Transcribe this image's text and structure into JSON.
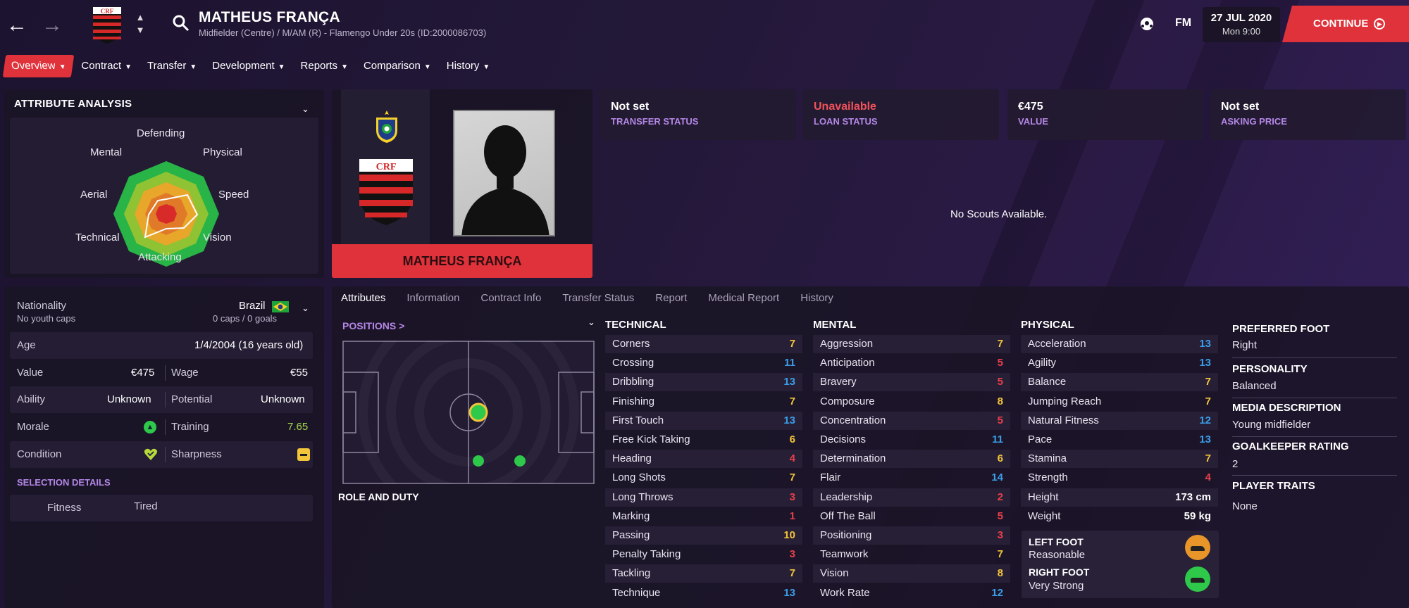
{
  "header": {
    "player_name": "MATHEUS FRANÇA",
    "player_subtitle": "Midfielder (Centre) / M/AM (R) - Flamengo Under 20s (ID:2000086703)",
    "fm_label": "FM",
    "date": "27 JUL 2020",
    "time": "Mon 9:00",
    "continue_label": "CONTINUE"
  },
  "menu": [
    {
      "label": "Overview"
    },
    {
      "label": "Contract"
    },
    {
      "label": "Transfer"
    },
    {
      "label": "Development"
    },
    {
      "label": "Reports"
    },
    {
      "label": "Comparison"
    },
    {
      "label": "History"
    }
  ],
  "attribute_analysis": {
    "title": "ATTRIBUTE ANALYSIS",
    "labels": {
      "defending": "Defending",
      "physical": "Physical",
      "speed": "Speed",
      "vision": "Vision",
      "attacking": "Attacking",
      "technical": "Technical",
      "aerial": "Aerial",
      "mental": "Mental"
    }
  },
  "info": {
    "nationality_label": "Nationality",
    "nationality_value": "Brazil",
    "youth_caps": "No youth caps",
    "caps": "0 caps / 0 goals",
    "age_label": "Age",
    "age_value": "1/4/2004 (16 years old)",
    "value_label": "Value",
    "value_value": "€475",
    "wage_label": "Wage",
    "wage_value": "€55",
    "ability_label": "Ability",
    "ability_value": "Unknown",
    "potential_label": "Potential",
    "potential_value": "Unknown",
    "morale_label": "Morale",
    "training_label": "Training",
    "training_value": "7.65",
    "condition_label": "Condition",
    "sharpness_label": "Sharpness",
    "selection_title": "SELECTION DETAILS",
    "fitness_label": "Fitness",
    "fitness_value": "Tired"
  },
  "card": {
    "name": "MATHEUS FRANÇA"
  },
  "status_tiles": [
    {
      "value": "Not set",
      "label": "TRANSFER STATUS",
      "color": "#ffffff"
    },
    {
      "value": "Unavailable",
      "label": "LOAN STATUS",
      "color": "#f0525a"
    },
    {
      "value": "€475",
      "label": "VALUE",
      "color": "#ffffff"
    },
    {
      "value": "Not set",
      "label": "ASKING PRICE",
      "color": "#ffffff"
    }
  ],
  "scouts_text": "No Scouts Available.",
  "tabs": [
    {
      "label": "Attributes"
    },
    {
      "label": "Information"
    },
    {
      "label": "Contract Info"
    },
    {
      "label": "Transfer Status"
    },
    {
      "label": "Report"
    },
    {
      "label": "Medical Report"
    },
    {
      "label": "History"
    }
  ],
  "positions_label": "POSITIONS >",
  "role_duty_label": "ROLE AND DUTY",
  "technical": {
    "title": "TECHNICAL",
    "rows": [
      {
        "name": "Corners",
        "value": "7"
      },
      {
        "name": "Crossing",
        "value": "11"
      },
      {
        "name": "Dribbling",
        "value": "13"
      },
      {
        "name": "Finishing",
        "value": "7"
      },
      {
        "name": "First Touch",
        "value": "13"
      },
      {
        "name": "Free Kick Taking",
        "value": "6"
      },
      {
        "name": "Heading",
        "value": "4"
      },
      {
        "name": "Long Shots",
        "value": "7"
      },
      {
        "name": "Long Throws",
        "value": "3"
      },
      {
        "name": "Marking",
        "value": "1"
      },
      {
        "name": "Passing",
        "value": "10"
      },
      {
        "name": "Penalty Taking",
        "value": "3"
      },
      {
        "name": "Tackling",
        "value": "7"
      },
      {
        "name": "Technique",
        "value": "13"
      }
    ]
  },
  "mental": {
    "title": "MENTAL",
    "rows": [
      {
        "name": "Aggression",
        "value": "7"
      },
      {
        "name": "Anticipation",
        "value": "5"
      },
      {
        "name": "Bravery",
        "value": "5"
      },
      {
        "name": "Composure",
        "value": "8"
      },
      {
        "name": "Concentration",
        "value": "5"
      },
      {
        "name": "Decisions",
        "value": "11"
      },
      {
        "name": "Determination",
        "value": "6"
      },
      {
        "name": "Flair",
        "value": "14"
      },
      {
        "name": "Leadership",
        "value": "2"
      },
      {
        "name": "Off The Ball",
        "value": "5"
      },
      {
        "name": "Positioning",
        "value": "3"
      },
      {
        "name": "Teamwork",
        "value": "7"
      },
      {
        "name": "Vision",
        "value": "8"
      },
      {
        "name": "Work Rate",
        "value": "12"
      }
    ]
  },
  "physical": {
    "title": "PHYSICAL",
    "rows": [
      {
        "name": "Acceleration",
        "value": "13"
      },
      {
        "name": "Agility",
        "value": "13"
      },
      {
        "name": "Balance",
        "value": "7"
      },
      {
        "name": "Jumping Reach",
        "value": "7"
      },
      {
        "name": "Natural Fitness",
        "value": "12"
      },
      {
        "name": "Pace",
        "value": "13"
      },
      {
        "name": "Stamina",
        "value": "7"
      },
      {
        "name": "Strength",
        "value": "4"
      },
      {
        "name": "Height",
        "value": "173 cm"
      },
      {
        "name": "Weight",
        "value": "59 kg"
      }
    ],
    "left_foot_label": "LEFT FOOT",
    "left_foot_value": "Reasonable",
    "right_foot_label": "RIGHT FOOT",
    "right_foot_value": "Very Strong"
  },
  "side": {
    "preferred_foot_label": "PREFERRED FOOT",
    "preferred_foot_value": "Right",
    "personality_label": "PERSONALITY",
    "personality_value": "Balanced",
    "media_label": "MEDIA DESCRIPTION",
    "media_value": "Young midfielder",
    "gk_label": "GOALKEEPER RATING",
    "gk_value": "2",
    "traits_label": "PLAYER TRAITS",
    "traits_value": "None"
  },
  "colors": {
    "accent": "#e0323a",
    "purple_label": "#b487e6",
    "attr_low": "#e8404a",
    "attr_mid": "#f3c53a",
    "attr_high": "#3a9ee8",
    "good_green": "#2ec84a"
  }
}
